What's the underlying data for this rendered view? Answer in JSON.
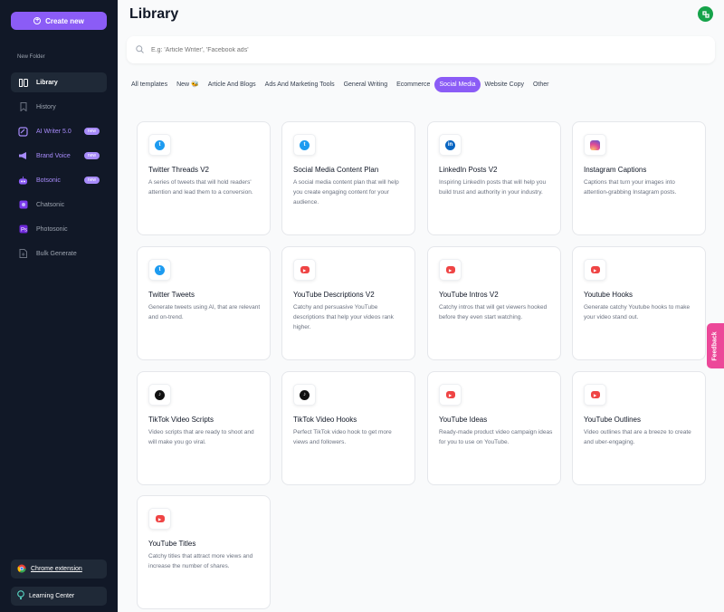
{
  "sidebar": {
    "create_label": "Create new",
    "folder_label": "New Folder",
    "items": [
      {
        "label": "Library",
        "icon": "library-icon"
      },
      {
        "label": "History",
        "icon": "bookmark-icon"
      },
      {
        "label": "AI Writer 5.0",
        "icon": "ai-writer-icon",
        "badge": "new"
      },
      {
        "label": "Brand Voice",
        "icon": "megaphone-icon",
        "badge": "new"
      },
      {
        "label": "Botsonic",
        "icon": "bot-icon",
        "badge": "new"
      },
      {
        "label": "Chatsonic",
        "icon": "chatsonic-icon"
      },
      {
        "label": "Photosonic",
        "icon": "photosonic-icon"
      },
      {
        "label": "Bulk Generate",
        "icon": "bulk-generate-icon"
      }
    ],
    "chrome_extension": "Chrome extension",
    "learning_center": "Learning Center"
  },
  "header": {
    "title": "Library"
  },
  "search": {
    "placeholder": "E.g: 'Article Writer', 'Facebook ads'"
  },
  "tabs": [
    {
      "label": "All templates"
    },
    {
      "label": "New 🐝"
    },
    {
      "label": "Article And Blogs"
    },
    {
      "label": "Ads And Marketing Tools"
    },
    {
      "label": "General Writing"
    },
    {
      "label": "Ecommerce"
    },
    {
      "label": "Social Media",
      "active": true
    },
    {
      "label": "Website Copy"
    },
    {
      "label": "Other"
    }
  ],
  "cards": [
    {
      "title": "Twitter Threads V2",
      "desc": "A series of tweets that will hold readers' attention and lead them to a conversion.",
      "icon": "twitter"
    },
    {
      "title": "Social Media Content Plan",
      "desc": "A social media content plan that will help you create engaging content for your audience.",
      "icon": "twitter"
    },
    {
      "title": "LinkedIn Posts V2",
      "desc": "Inspiring LinkedIn posts that will help you build trust and authority in your industry.",
      "icon": "linkedin"
    },
    {
      "title": "Instagram Captions",
      "desc": "Captions that turn your images into attention-grabbing Instagram posts.",
      "icon": "instagram"
    },
    {
      "title": "Twitter Tweets",
      "desc": "Generate tweets using AI, that are relevant and on-trend.",
      "icon": "twitter"
    },
    {
      "title": "YouTube Descriptions V2",
      "desc": "Catchy and persuasive YouTube descriptions that help your videos rank higher.",
      "icon": "youtube"
    },
    {
      "title": "YouTube Intros V2",
      "desc": "Catchy intros that will get viewers hooked before they even start watching.",
      "icon": "youtube"
    },
    {
      "title": "Youtube Hooks",
      "desc": "Generate catchy Youtube hooks to make your video stand out.",
      "icon": "youtube"
    },
    {
      "title": "TikTok Video Scripts",
      "desc": "Video scripts that are ready to shoot and will make you go viral.",
      "icon": "tiktok"
    },
    {
      "title": "TikTok Video Hooks",
      "desc": "Perfect TikTok video hook to get more views and followers.",
      "icon": "tiktok"
    },
    {
      "title": "YouTube Ideas",
      "desc": "Ready-made product video campaign ideas for you to use on YouTube.",
      "icon": "youtube"
    },
    {
      "title": "YouTube Outlines",
      "desc": "Video outlines that are a breeze to create and uber-engaging.",
      "icon": "youtube"
    },
    {
      "title": "YouTube Titles",
      "desc": "Catchy titles that attract more views and increase the number of shares.",
      "icon": "youtube"
    }
  ],
  "feedback_label": "Feedback",
  "colors": {
    "accent": "#8b5cf6",
    "sidebar_bg": "#111827",
    "feedback": "#ec4899",
    "avatar": "#16a34a"
  }
}
